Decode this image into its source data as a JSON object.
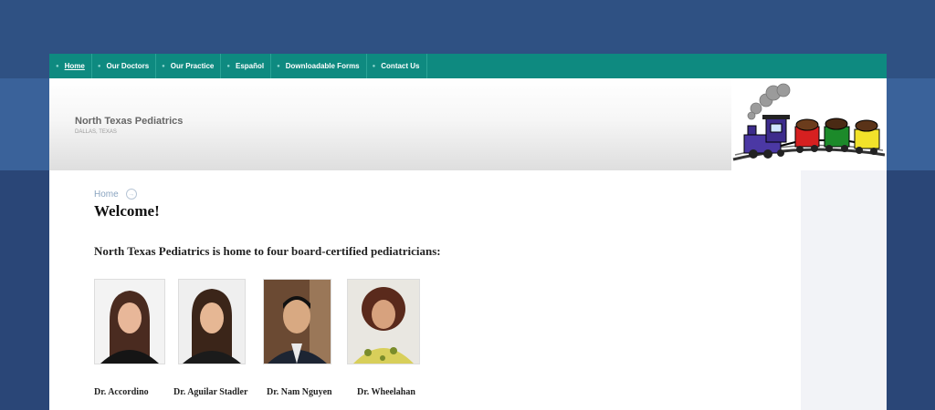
{
  "nav": {
    "items": [
      {
        "label": "Home",
        "active": true
      },
      {
        "label": "Our Doctors"
      },
      {
        "label": "Our Practice"
      },
      {
        "label": "Español"
      },
      {
        "label": "Downloadable Forms"
      },
      {
        "label": "Contact Us"
      }
    ]
  },
  "header": {
    "title": "North Texas Pediatrics",
    "subtitle": "DALLAS, TEXAS"
  },
  "breadcrumb": {
    "home": "Home"
  },
  "main": {
    "heading": "Welcome!",
    "intro": "North Texas Pediatrics is home to four board-certified pediatricians:",
    "doctors": [
      {
        "name": "Dr. Accordino"
      },
      {
        "name": "Dr. Aguilar Stadler"
      },
      {
        "name": "Dr. Nam Nguyen"
      },
      {
        "name": "Dr. Wheelahan"
      }
    ]
  },
  "colors": {
    "nav_bg": "#0e8a80",
    "page_bg": "#2d4a7a",
    "header_title": "#666666"
  },
  "icons": {
    "nav_bullet": "bullet-icon",
    "breadcrumb_separator": "arrow-circle-icon",
    "logo": "train-logo"
  }
}
